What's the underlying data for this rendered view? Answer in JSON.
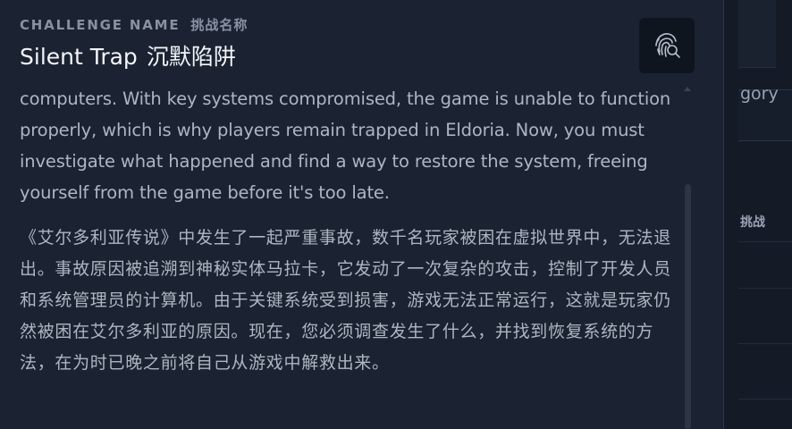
{
  "background": {
    "category_label": "gory",
    "challenge_label": "挑战"
  },
  "header": {
    "label_en": "CHALLENGE NAME",
    "label_zh": "挑战名称",
    "title_en": "Silent Trap",
    "title_zh": "沉默陷阱"
  },
  "toolbar": {
    "icon": "fingerprint-search-icon"
  },
  "description": {
    "en": "computers. With key systems compromised, the game is unable to function properly, which is why players remain trapped in Eldoria. Now, you must investigate what happened and find a way to restore the system, freeing yourself from the game before it's too late.",
    "zh": "《艾尔多利亚传说》中发生了一起严重事故，数千名玩家被困在虚拟世界中，无法退出。事故原因被追溯到神秘实体马拉卡，它发动了一次复杂的攻击，控制了开发人员和系统管理员的计算机。由于关键系统受到损害，游戏无法正常运行，这就是玩家仍然被困在艾尔多利亚的原因。现在，您必须调查发生了什么，并找到恢复系统的方法，在为时已晚之前将自己从游戏中解救出来。"
  },
  "colors": {
    "panel": "#1b2332",
    "page": "#141b27",
    "text": "#aeb5c2",
    "title": "#f3f5f8",
    "label": "#8891a2"
  }
}
